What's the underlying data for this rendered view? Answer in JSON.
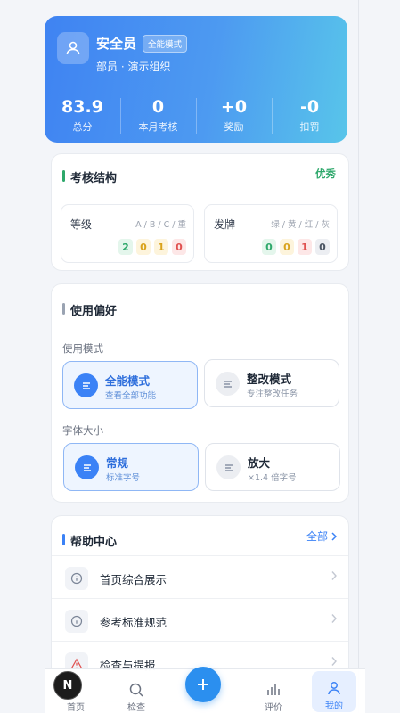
{
  "profile": {
    "name": "安全员",
    "badge": "全能模式",
    "subtitle": "部员 · 演示组织",
    "avatar_icon": "user-icon",
    "stats": [
      {
        "value": "83.9",
        "label": "总分"
      },
      {
        "value": "0",
        "label": "本月考核"
      },
      {
        "value": "+0",
        "label": "奖励"
      },
      {
        "value": "-0",
        "label": "扣罚"
      }
    ]
  },
  "exam": {
    "title": "考核结构",
    "tag": "优秀",
    "grade": {
      "title": "等级",
      "legend": "A / B / C / 重",
      "values": [
        "2",
        "0",
        "1",
        "0"
      ]
    },
    "card": {
      "title": "发牌",
      "legend": "绿 / 黄 / 红 / 灰",
      "values": [
        "0",
        "0",
        "1",
        "0"
      ]
    }
  },
  "pref": {
    "title": "使用偏好",
    "mode_label": "使用模式",
    "modes": [
      {
        "title": "全能模式",
        "desc": "查看全部功能"
      },
      {
        "title": "整改模式",
        "desc": "专注整改任务"
      }
    ],
    "font_label": "字体大小",
    "fonts": [
      {
        "title": "常规",
        "desc": "标准字号"
      },
      {
        "title": "放大",
        "desc": "×1.4 倍字号"
      }
    ]
  },
  "help": {
    "title": "帮助中心",
    "all_label": "全部",
    "items": [
      {
        "label": "首页综合展示",
        "icon": "info-icon"
      },
      {
        "label": "参考标准规范",
        "icon": "info-icon"
      },
      {
        "label": "检查与提报",
        "icon": "warning-icon"
      }
    ]
  },
  "nav": {
    "home": "首页",
    "check": "检查",
    "rating": "评价",
    "mine": "我的",
    "badge_letter": "N"
  },
  "colors": {
    "accent": "#3b82f6",
    "green": "#2ea86b",
    "red": "#e0504f",
    "yellow": "#d9a21b"
  }
}
